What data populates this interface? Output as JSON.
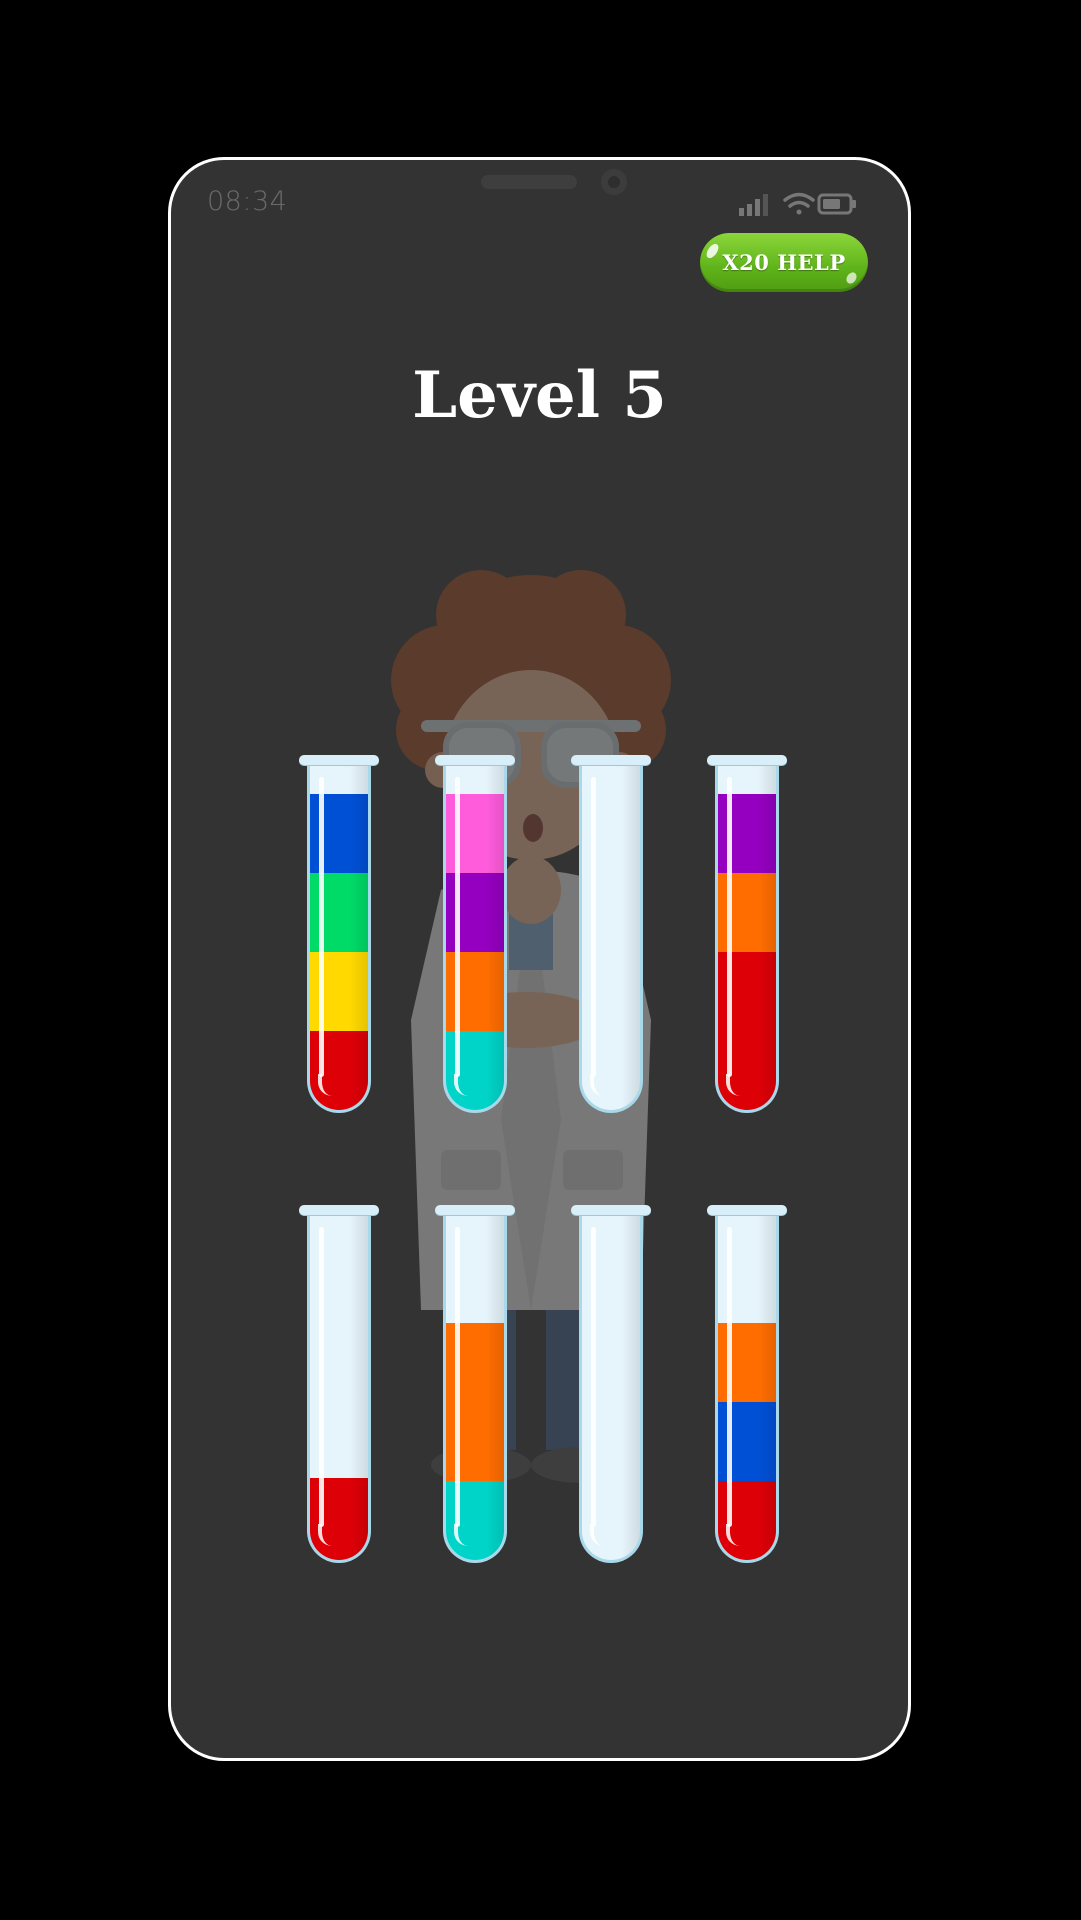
{
  "status_bar": {
    "time": "08:34"
  },
  "help_button": {
    "label": "X20 HELP",
    "color": "#6cc223"
  },
  "level": {
    "title": "Level 5"
  },
  "tube_capacity": 4,
  "tubes": [
    {
      "id": "tube-1",
      "layers_bottom_to_top": [
        "#dd0007",
        "#ffd900",
        "#00da67",
        "#0050d6"
      ]
    },
    {
      "id": "tube-2",
      "layers_bottom_to_top": [
        "#00d4c8",
        "#ff6d00",
        "#9500c0",
        "#ff5cdc"
      ]
    },
    {
      "id": "tube-3",
      "layers_bottom_to_top": []
    },
    {
      "id": "tube-4",
      "layers_bottom_to_top": [
        "#dd0007",
        "#dd0007",
        "#ff6d00",
        "#9500c0"
      ]
    },
    {
      "id": "tube-5",
      "layers_bottom_to_top": [
        "#dd0007"
      ]
    },
    {
      "id": "tube-6",
      "layers_bottom_to_top": [
        "#00d4c8",
        "#ff6d00",
        "#ff6d00"
      ]
    },
    {
      "id": "tube-7",
      "layers_bottom_to_top": []
    },
    {
      "id": "tube-8",
      "layers_bottom_to_top": [
        "#dd0007",
        "#0050d6",
        "#ff6d00"
      ]
    }
  ],
  "background_art": {
    "icon": "scientist-character"
  }
}
